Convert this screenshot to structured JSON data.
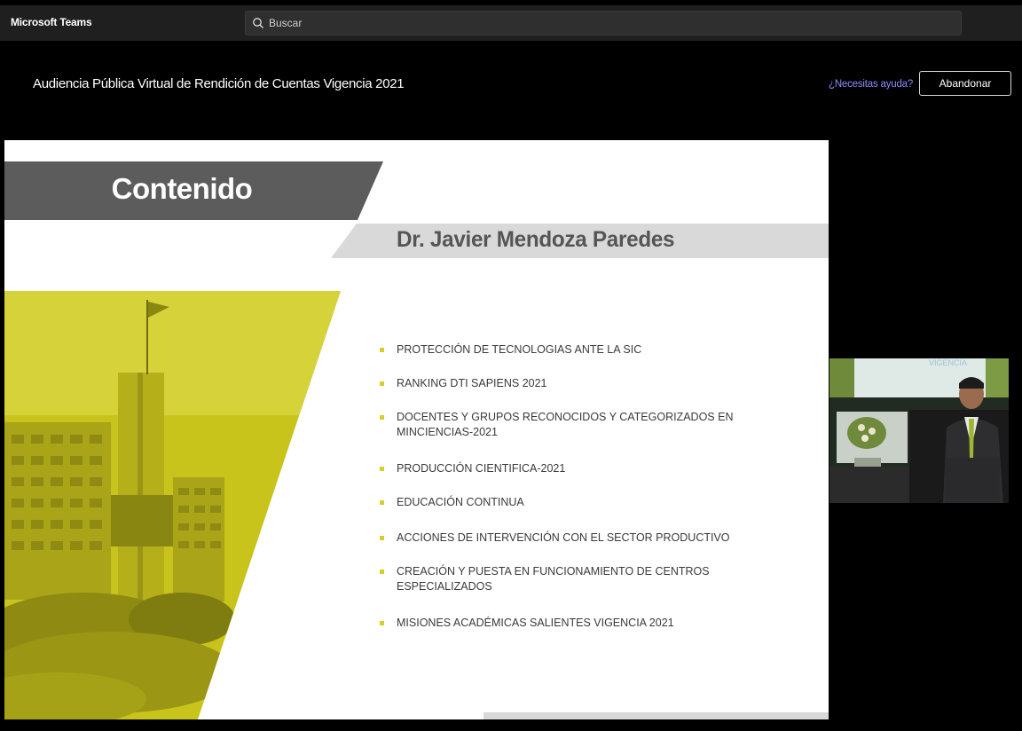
{
  "app": {
    "title": "Microsoft Teams"
  },
  "search": {
    "placeholder": "Buscar"
  },
  "meeting": {
    "title": "Audiencia Pública Virtual de Rendición de Cuentas Vigencia 2021",
    "help_label": "¿Necesitas ayuda?",
    "leave_label": "Abandonar"
  },
  "slide": {
    "heading": "Contenido",
    "presenter": "Dr. Javier Mendoza Paredes",
    "accent_color": "#d6cf2a",
    "items": [
      "PROTECCIÓN DE TECNOLOGIAS ANTE LA SIC",
      "RANKING DTI SAPIENS 2021",
      "DOCENTES Y GRUPOS RECONOCIDOS Y CATEGORIZADOS EN MINCIENCIAS-2021",
      "PRODUCCIÓN CIENTIFICA-2021",
      "EDUCACIÓN CONTINUA",
      "ACCIONES DE INTERVENCIÓN CON EL SECTOR PRODUCTIVO",
      "CREACIÓN Y PUESTA EN FUNCIONAMIENTO DE CENTROS ESPECIALIZADOS",
      "MISIONES ACADÉMICAS SALIENTES VIGENCIA 2021"
    ]
  },
  "video": {
    "backdrop_text": "VIGENCIA"
  }
}
